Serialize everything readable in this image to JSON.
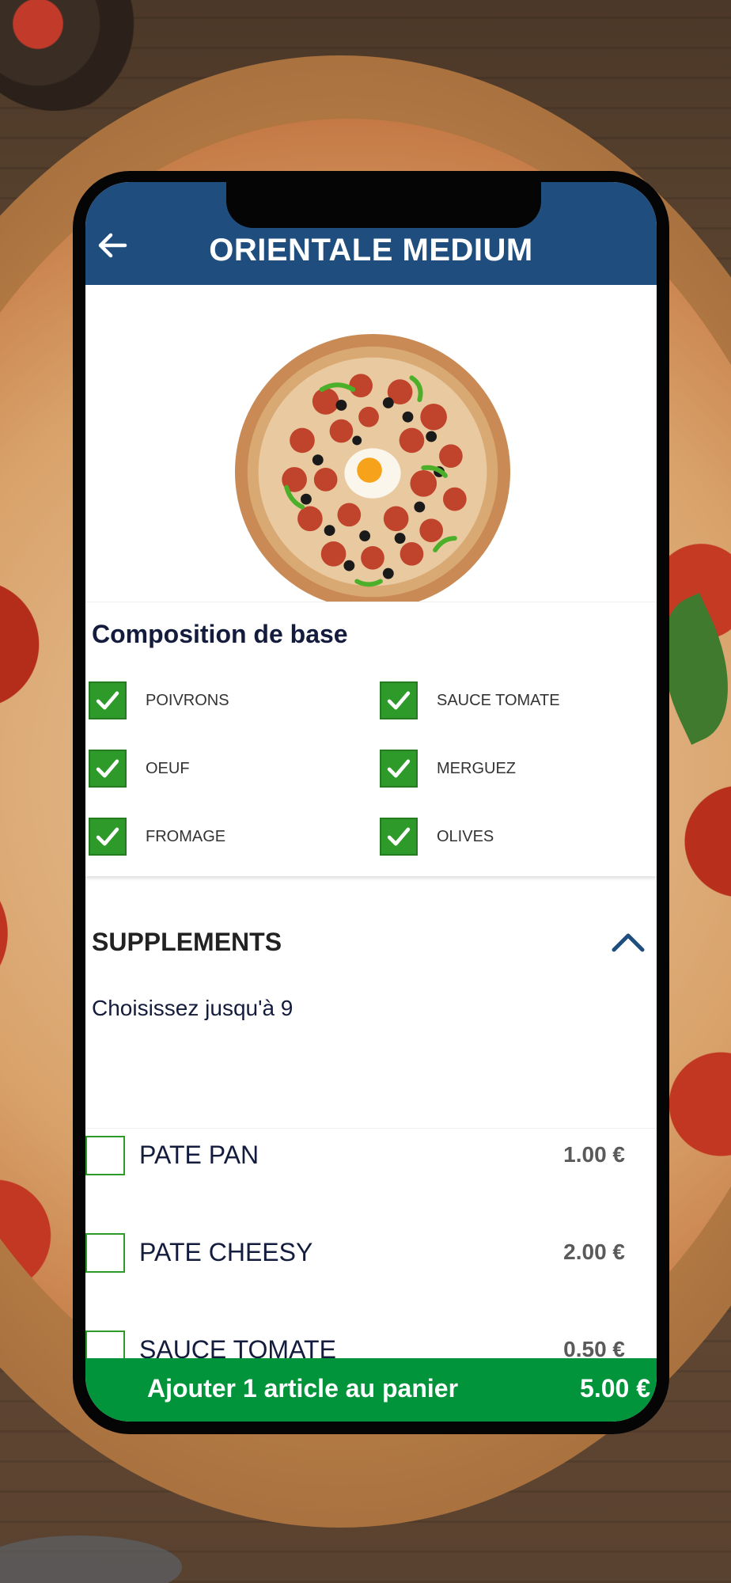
{
  "header": {
    "title": "ORIENTALE MEDIUM",
    "back_icon": "arrow-left-icon"
  },
  "composition": {
    "title": "Composition de base",
    "ingredients": [
      {
        "label": "POIVRONS",
        "checked": true
      },
      {
        "label": "SAUCE TOMATE",
        "checked": true
      },
      {
        "label": "OEUF",
        "checked": true
      },
      {
        "label": "MERGUEZ",
        "checked": true
      },
      {
        "label": "FROMAGE",
        "checked": true
      },
      {
        "label": "OLIVES",
        "checked": true
      }
    ]
  },
  "supplements": {
    "title": "SUPPLEMENTS",
    "subtitle": "Choisissez jusqu'à 9",
    "items": [
      {
        "name": "PATE PAN",
        "price": "1.00 €",
        "checked": false
      },
      {
        "name": "PATE CHEESY",
        "price": "2.00 €",
        "checked": false
      },
      {
        "name": "SAUCE TOMATE",
        "price": "0.50 €",
        "checked": false
      }
    ]
  },
  "cart": {
    "label": "Ajouter 1 article au panier",
    "price": "5.00 €"
  },
  "colors": {
    "header": "#1e4d7e",
    "check": "#2e9a2a",
    "cart": "#02943a",
    "title_text": "#141c3d"
  }
}
